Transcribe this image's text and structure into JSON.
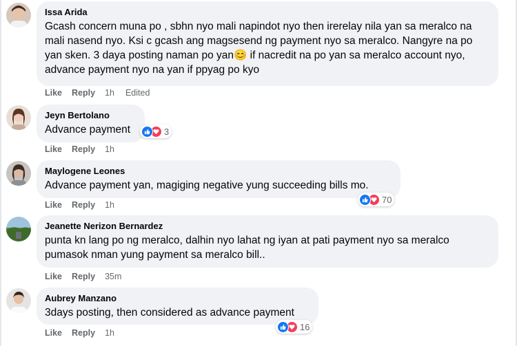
{
  "actions": {
    "like": "Like",
    "reply": "Reply",
    "edited": "Edited"
  },
  "comments": [
    {
      "author": "Issa Arida",
      "text": "Gcash concern muna po , sbhn nyo mali napindot nyo then irerelay nila yan sa meralco na mali nasend nyo. Ksi c gcash ang magsesend ng payment nyo sa meralco. Nangyre na po yan sken. 3 daya posting naman po yan😊 if nacredit na po yan sa meralco account nyo, advance payment nyo na yan if ppyag po kyo",
      "time": "1h"
    },
    {
      "author": "Jeyn Bertolano",
      "text": "Advance payment",
      "time": "1h",
      "reaction_count": "3"
    },
    {
      "author": "Maylogene Leones",
      "text": "Advance payment yan, magiging negative yung succeeding bills mo.",
      "time": "1h",
      "reaction_count": "70"
    },
    {
      "author": "Jeanette Nerizon Bernardez",
      "text": "punta kn lang po ng meralco, dalhin nyo lahat ng iyan at pati payment nyo sa meralco pumasok nman yung payment sa meralco bill..",
      "time": "35m"
    },
    {
      "author": "Aubrey Manzano",
      "text": "3days posting, then considered as advance payment",
      "time": "1h",
      "reaction_count": "16"
    }
  ],
  "colors": {
    "like": "#1877f2",
    "love": "#f33e58",
    "bubble": "#f0f2f5",
    "meta": "#65676b"
  }
}
